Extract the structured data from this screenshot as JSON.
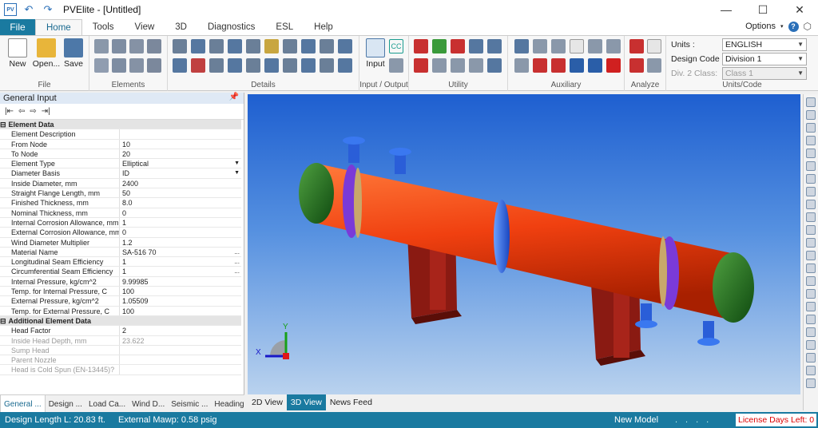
{
  "window": {
    "title": "PVElite - [Untitled]",
    "app_icon": "PV"
  },
  "window_controls": {
    "minimize": "—",
    "maximize": "☐",
    "close": "✕"
  },
  "menu": {
    "file": "File",
    "tabs": [
      "Home",
      "Tools",
      "View",
      "3D",
      "Diagnostics",
      "ESL",
      "Help"
    ],
    "options": "Options",
    "help_icon": "?"
  },
  "ribbon": {
    "file_group": {
      "label": "File",
      "buttons": [
        "New",
        "Open...",
        "Save"
      ]
    },
    "elements_label": "Elements",
    "details_label": "Details",
    "io_group": {
      "label": "Input / Output",
      "input_button": "Input",
      "cc_icon": "CC"
    },
    "utility_label": "Utility",
    "auxiliary_label": "Auxiliary",
    "analyze_label": "Analyze",
    "units_code": {
      "label": "Units/Code",
      "units_label": "Units :",
      "units_value": "ENGLISH",
      "design_code_label": "Design Code :",
      "design_code_value": "Division 1",
      "div2_label": "Div. 2 Class:",
      "div2_value": "Class 1"
    }
  },
  "left_panel": {
    "title": "General Input",
    "pin": "📌",
    "sections": [
      {
        "title": "Element Data",
        "rows": [
          {
            "k": "Element Description",
            "v": ""
          },
          {
            "k": "From Node",
            "v": "10"
          },
          {
            "k": "To Node",
            "v": "20"
          },
          {
            "k": "Element Type",
            "v": "Elliptical",
            "dd": true
          },
          {
            "k": "Diameter Basis",
            "v": "ID",
            "dd": true
          },
          {
            "k": "Inside Diameter, mm",
            "v": "2400"
          },
          {
            "k": "Straight Flange Length, mm",
            "v": "50"
          },
          {
            "k": "Finished Thickness, mm",
            "v": "8.0"
          },
          {
            "k": "Nominal Thickness, mm",
            "v": "0"
          },
          {
            "k": "Internal Corrosion Allowance, mm",
            "v": "1"
          },
          {
            "k": "External Corrosion Allowance, mm",
            "v": "0"
          },
          {
            "k": "Wind Diameter Multiplier",
            "v": "1.2"
          },
          {
            "k": "Material Name",
            "v": "SA-516 70",
            "ell": true
          },
          {
            "k": "Longitudinal Seam Efficiency",
            "v": "1",
            "ell": true
          },
          {
            "k": "Circumferential Seam Efficiency",
            "v": "1",
            "ell": true
          },
          {
            "k": "Internal Pressure, kg/cm^2",
            "v": "9.99985"
          },
          {
            "k": "Temp. for Internal Pressure, C",
            "v": "100"
          },
          {
            "k": "External Pressure, kg/cm^2",
            "v": "1.05509"
          },
          {
            "k": "Temp. for External Pressure, C",
            "v": "100"
          }
        ]
      },
      {
        "title": "Additional Element Data",
        "rows": [
          {
            "k": "Head Factor",
            "v": "2"
          },
          {
            "k": "Inside Head Depth, mm",
            "v": "23.622",
            "grey": true
          },
          {
            "k": "Sump Head",
            "v": "",
            "grey": true
          },
          {
            "k": "Parent Nozzle",
            "v": "",
            "grey": true
          },
          {
            "k": "Head is Cold Spun (EN-13445)?",
            "v": "",
            "grey": true
          }
        ]
      }
    ],
    "tabs": [
      "General ...",
      "Design ...",
      "Load Ca...",
      "Wind D...",
      "Seismic ...",
      "Heading"
    ]
  },
  "viewport": {
    "tabs": [
      "2D View",
      "3D View",
      "News Feed"
    ],
    "axis_x": "X",
    "axis_y": "Y"
  },
  "status": {
    "design_length": "Design Length L: 20.83 ft.",
    "mawp": "External Mawp: 0.58 psig",
    "model": "New Model",
    "dots": "....",
    "license": "License Days Left: 0"
  }
}
